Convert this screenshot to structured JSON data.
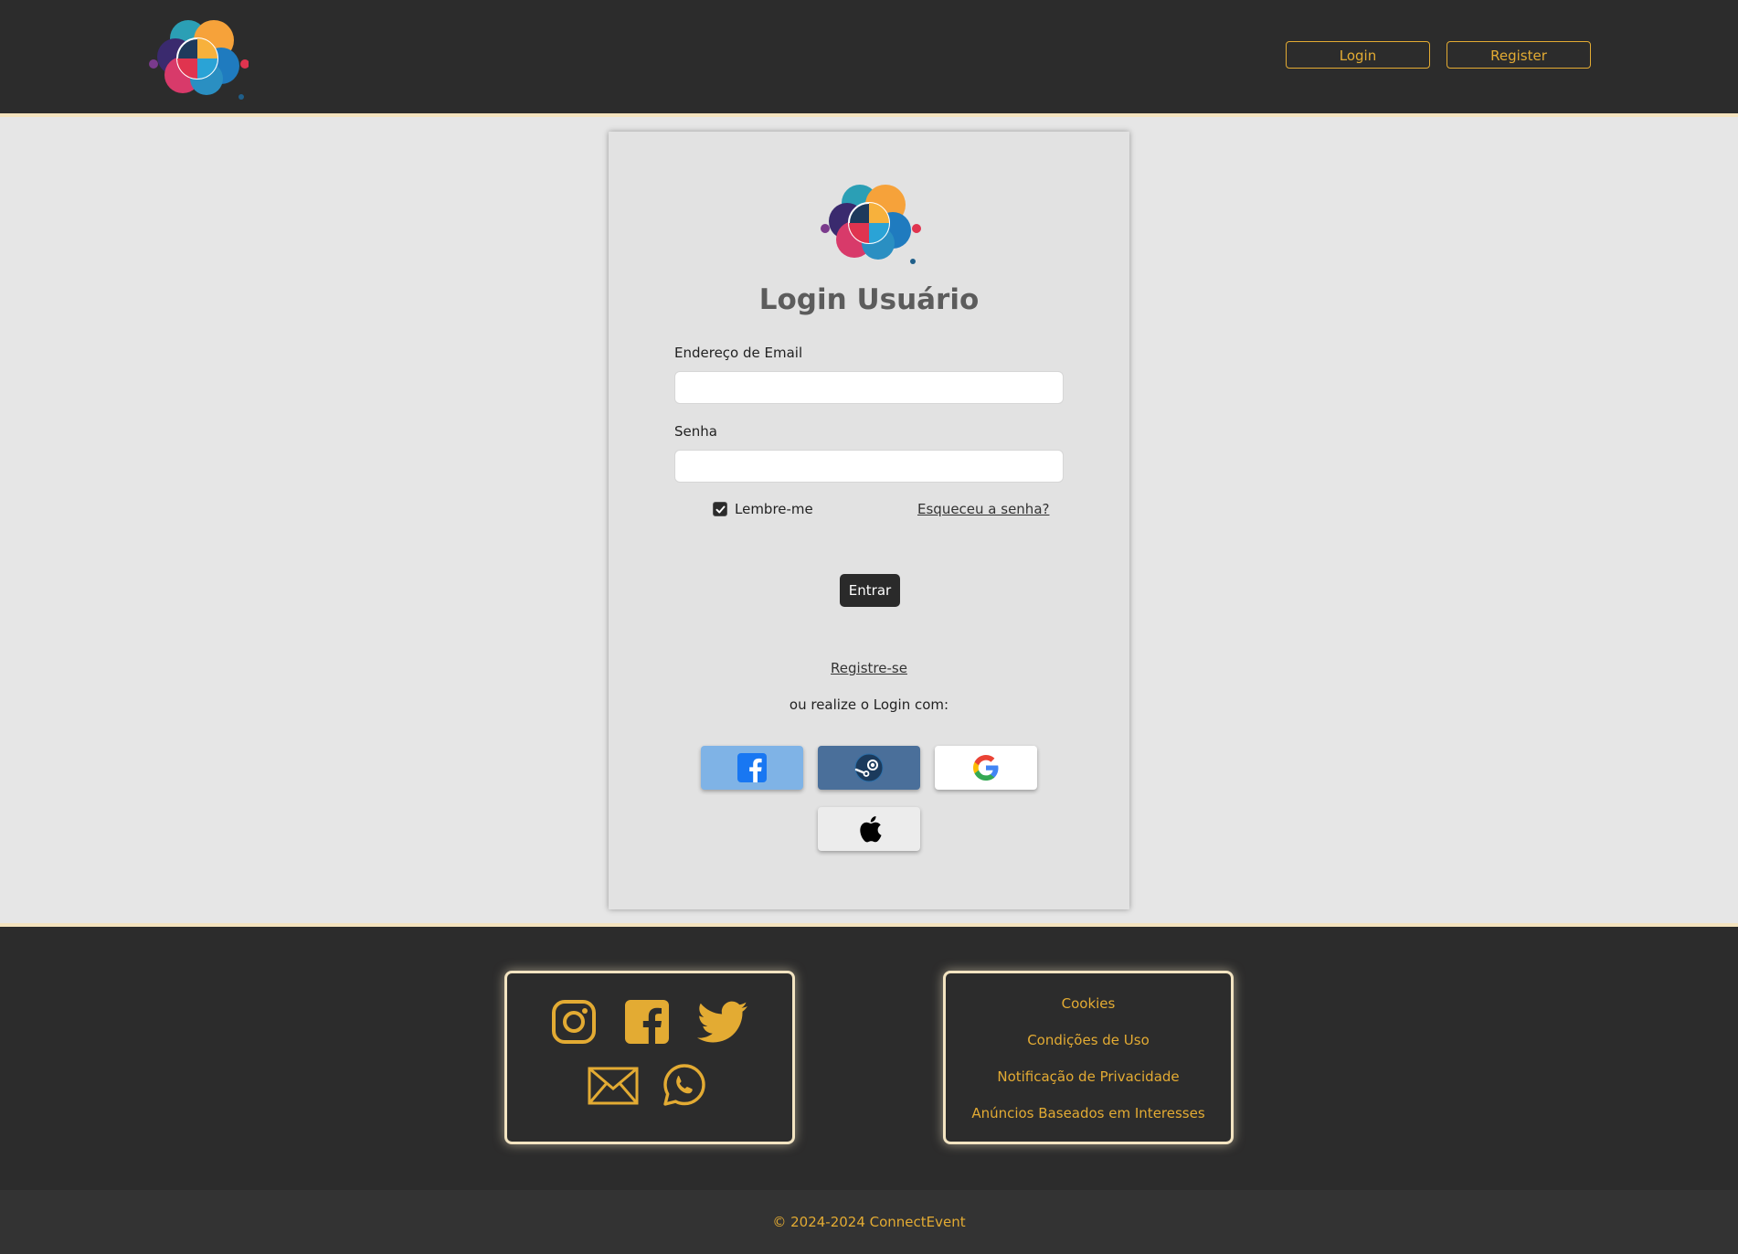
{
  "header": {
    "login_label": "Login",
    "register_label": "Register"
  },
  "login": {
    "title": "Login Usuário",
    "email_label": "Endereço de Email",
    "email_value": "",
    "password_label": "Senha",
    "password_value": "",
    "remember_label": "Lembre-me",
    "remember_checked": true,
    "forgot_label": "Esqueceu a senha?",
    "submit_label": "Entrar",
    "register_label": "Registre-se",
    "alt_login_label": "ou realize o Login com:",
    "social_providers": [
      "facebook-icon",
      "steam-icon",
      "google-icon",
      "apple-icon"
    ]
  },
  "footer": {
    "social_icons": [
      "instagram-icon",
      "facebook-icon",
      "twitter-icon",
      "mail-icon",
      "whatsapp-icon"
    ],
    "links": [
      "Cookies",
      "Condições de Uso",
      "Notificação de Privacidade",
      "Anúncios Baseados em Interesses"
    ],
    "copyright": "© 2024-2024 ConnectEvent"
  },
  "colors": {
    "accent": "#e3ab33",
    "dark": "#2c2c2c",
    "border_glow": "#f4e3be"
  }
}
